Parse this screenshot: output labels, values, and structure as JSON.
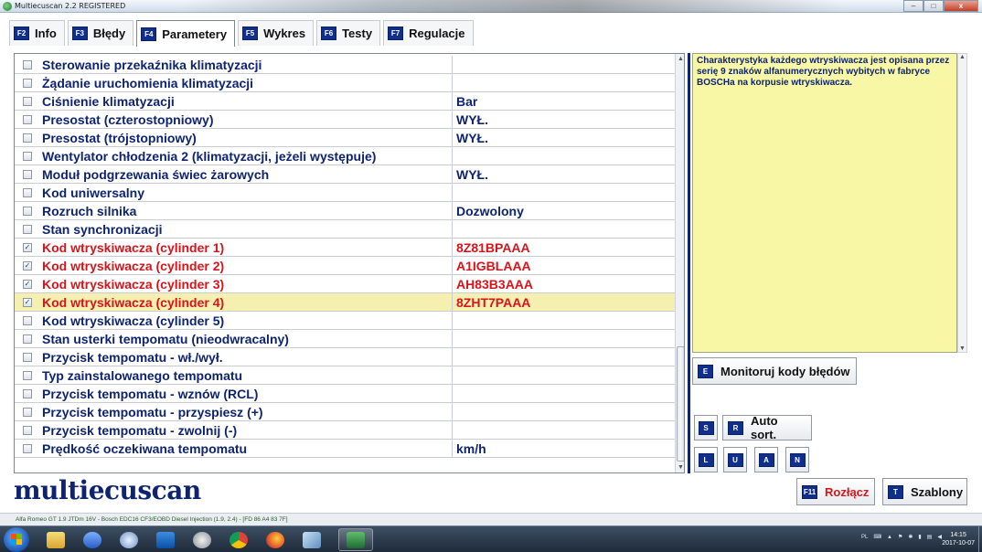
{
  "window": {
    "title": "Multiecuscan 2.2 REGISTERED",
    "controls": {
      "minimize": "–",
      "maximize": "□",
      "close": "x"
    }
  },
  "tabs": [
    {
      "key": "F2",
      "label": "Info"
    },
    {
      "key": "F3",
      "label": "Błędy"
    },
    {
      "key": "F4",
      "label": "Parametery",
      "active": true
    },
    {
      "key": "F5",
      "label": "Wykres"
    },
    {
      "key": "F6",
      "label": "Testy"
    },
    {
      "key": "F7",
      "label": "Regulacje"
    }
  ],
  "parameters": [
    {
      "name": "Sterowanie przekaźnika klimatyzacji",
      "value": "",
      "checked": false
    },
    {
      "name": "Żądanie uruchomienia klimatyzacji",
      "value": "",
      "checked": false
    },
    {
      "name": "Ciśnienie klimatyzacji",
      "value": " Bar",
      "checked": false
    },
    {
      "name": "Presostat (czterostopniowy)",
      "value": "WYŁ.",
      "checked": false
    },
    {
      "name": "Presostat (trójstopniowy)",
      "value": "WYŁ.",
      "checked": false
    },
    {
      "name": "Wentylator chłodzenia 2 (klimatyzacji, jeżeli występuje)",
      "value": "",
      "checked": false
    },
    {
      "name": "Moduł podgrzewania świec żarowych",
      "value": "WYŁ.",
      "checked": false
    },
    {
      "name": "Kod uniwersalny",
      "value": "",
      "checked": false
    },
    {
      "name": "Rozruch silnika",
      "value": "Dozwolony",
      "checked": false
    },
    {
      "name": "Stan synchronizacji",
      "value": "",
      "checked": false
    },
    {
      "name": "Kod wtryskiwacza (cylinder 1)",
      "value": "8Z81BPAAA",
      "checked": true
    },
    {
      "name": "Kod wtryskiwacza (cylinder 2)",
      "value": "A1IGBLAAA",
      "checked": true
    },
    {
      "name": "Kod wtryskiwacza (cylinder 3)",
      "value": "AH83B3AAA",
      "checked": true
    },
    {
      "name": "Kod wtryskiwacza (cylinder 4)",
      "value": "8ZHT7PAAA",
      "checked": true,
      "selected": true
    },
    {
      "name": "Kod wtryskiwacza (cylinder 5)",
      "value": "",
      "checked": false
    },
    {
      "name": "Stan usterki tempomatu (nieodwracalny)",
      "value": "",
      "checked": false
    },
    {
      "name": "Przycisk tempomatu - wł./wył.",
      "value": "",
      "checked": false
    },
    {
      "name": "Typ zainstalowanego tempomatu",
      "value": "",
      "checked": false
    },
    {
      "name": "Przycisk tempomatu - wznów (RCL)",
      "value": "",
      "checked": false
    },
    {
      "name": "Przycisk tempomatu - przyspiesz (+)",
      "value": "",
      "checked": false
    },
    {
      "name": "Przycisk tempomatu - zwolnij (-)",
      "value": "",
      "checked": false
    },
    {
      "name": "Prędkość oczekiwana tempomatu",
      "value": " km/h",
      "checked": false
    }
  ],
  "description": "Charakterystyka każdego wtryskiwacza jest opisana przez serię 9 znaków alfanumerycznych wybitych w fabryce BOSCHa na korpusie wtryskiwacza.",
  "buttons": {
    "monitor": {
      "key": "E",
      "label": "Monitoruj kody błędów"
    },
    "s": {
      "key": "S"
    },
    "autosort": {
      "key": "R",
      "label": "Auto sort."
    },
    "l": {
      "key": "L"
    },
    "u": {
      "key": "U"
    },
    "a": {
      "key": "A"
    },
    "n": {
      "key": "N"
    },
    "disconnect": {
      "key": "F11",
      "label": "Rozłącz"
    },
    "templates": {
      "key": "T",
      "label": "Szablony"
    }
  },
  "logo": "multiecuscan",
  "status": "Alfa Romeo GT 1.9 JTDm 16V - Bosch EDC16 CF3/EOBD Diesel Injection (1.9, 2.4) - [FD 86 A4 83 7F]",
  "taskbar": {
    "tray_lang": "PL",
    "time": "14:15",
    "date": "2017-10-07"
  },
  "colors": {
    "accent_navy": "#0e2470",
    "key_badge": "#102e8c",
    "error_red": "#d8141b",
    "desc_yellow": "#f8f7a6",
    "row_highlight": "#f5f0b0"
  }
}
